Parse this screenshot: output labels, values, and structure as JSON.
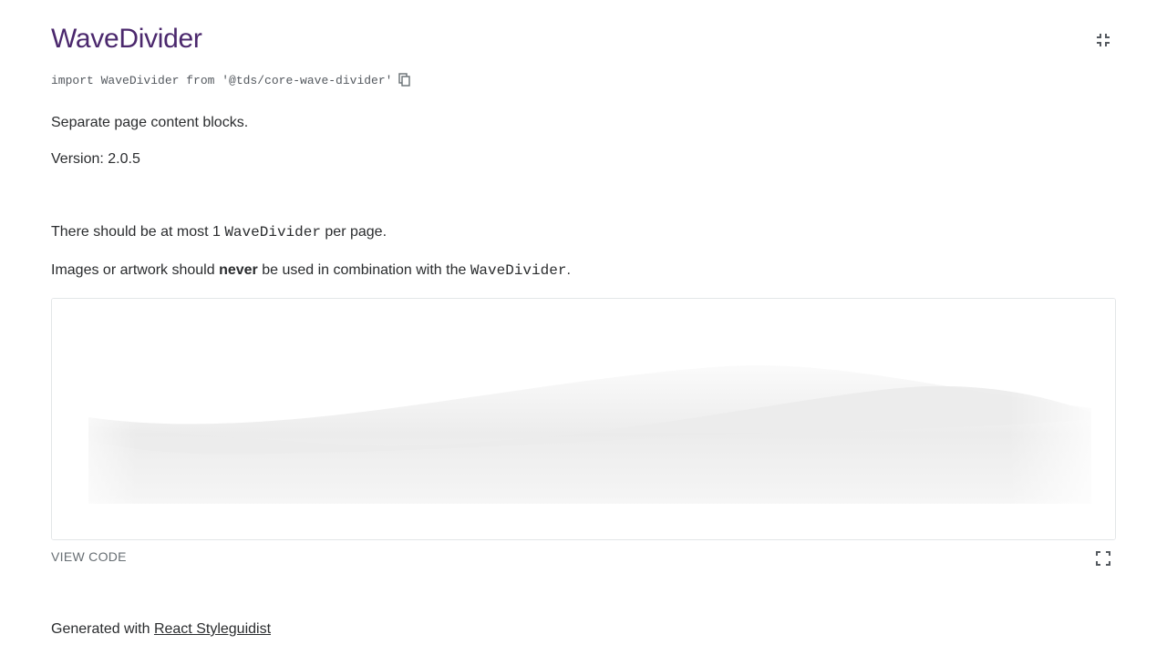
{
  "header": {
    "title": "WaveDivider",
    "collapse_icon": "collapse-arrows-icon"
  },
  "import": {
    "code": "import WaveDivider from '@tds/core-wave-divider'",
    "copy_icon": "copy-icon"
  },
  "description": "Separate page content blocks.",
  "version": "Version: 2.0.5",
  "guidelines": {
    "line1_prefix": "There should be at most 1 ",
    "line1_code": "WaveDivider",
    "line1_suffix": " per page.",
    "line2_prefix": "Images or artwork should ",
    "line2_bold": "never",
    "line2_middle": " be used in combination with the ",
    "line2_code": "WaveDivider",
    "line2_suffix": "."
  },
  "example": {
    "view_code_label": "VIEW CODE",
    "fullscreen_icon": "fullscreen-icon"
  },
  "footer": {
    "prefix": "Generated with ",
    "link_label": "React Styleguidist"
  },
  "colors": {
    "title": "#4b286d",
    "text": "#2a2c2e",
    "muted": "#676e73",
    "border": "#e3e6e8"
  }
}
